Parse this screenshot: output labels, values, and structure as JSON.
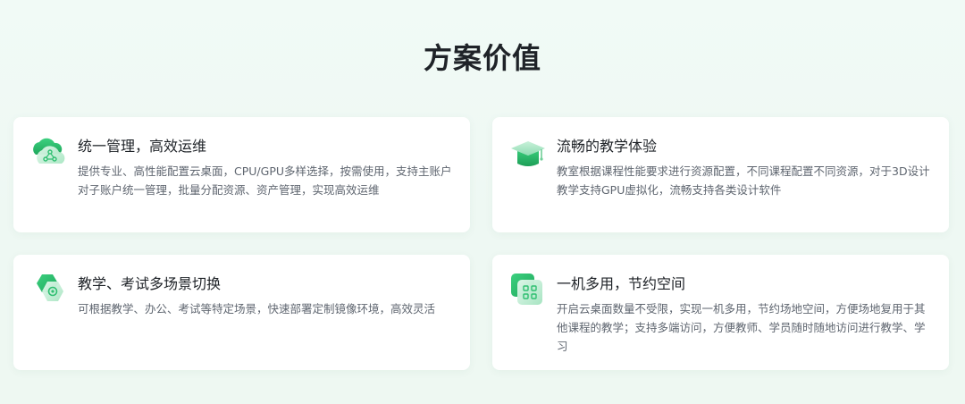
{
  "page": {
    "title": "方案价值"
  },
  "theme": {
    "accent": "#2fbf71",
    "accent_light": "#9fe3bd",
    "text_primary": "#1f2328",
    "text_secondary": "#5f6670",
    "background": "#eff9f4"
  },
  "cards": [
    {
      "icon": "cloud-network-icon",
      "title": "统一管理，高效运维",
      "description": "提供专业、高性能配置云桌面，CPU/GPU多样选择，按需使用，支持主账户对子账户统一管理，批量分配资源、资产管理，实现高效运维"
    },
    {
      "icon": "graduation-cap-icon",
      "title": "流畅的教学体验",
      "description": "教室根据课程性能要求进行资源配置，不同课程配置不同资源，对于3D设计教学支持GPU虚拟化，流畅支持各类设计软件"
    },
    {
      "icon": "camera-scene-icon",
      "title": "教学、考试多场景切换",
      "description": "可根据教学、办公、考试等特定场景，快速部署定制镜像环境，高效灵活"
    },
    {
      "icon": "multi-app-grid-icon",
      "title": "一机多用，节约空间",
      "description": "开启云桌面数量不受限，实现一机多用，节约场地空间，方便场地复用于其他课程的教学；支持多端访问，方便教师、学员随时随地访问进行教学、学习"
    }
  ]
}
